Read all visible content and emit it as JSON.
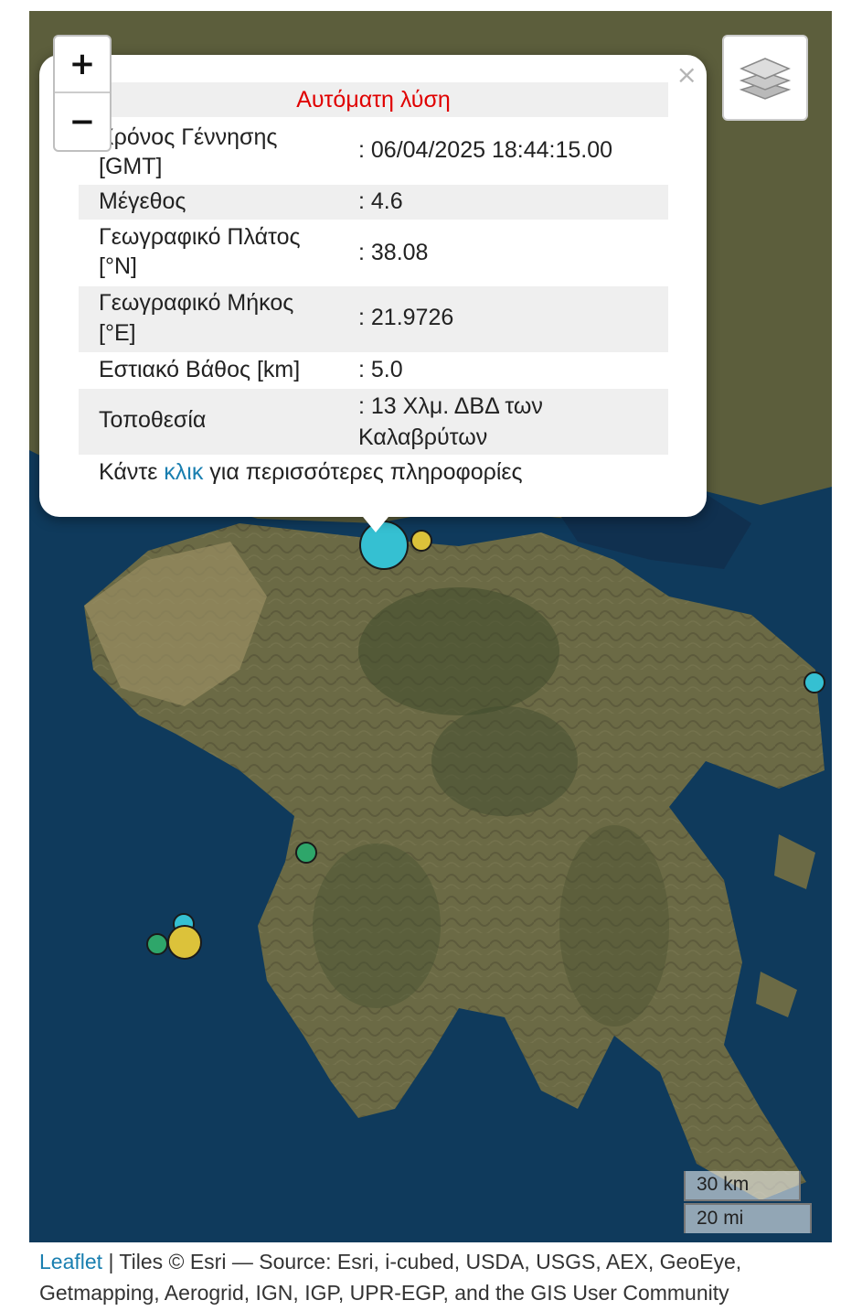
{
  "zoom": {
    "in_label": "+",
    "out_label": "−"
  },
  "layers": {
    "icon": "layers-icon"
  },
  "popup": {
    "close_label": "×",
    "title": "Αυτόματη λύση",
    "rows": [
      {
        "label": "Χρόνος Γέννησης [GMT]",
        "value": ": 06/04/2025 18:44:15.00"
      },
      {
        "label": "Μέγεθος",
        "value": ": 4.6"
      },
      {
        "label": "Γεωγραφικό Πλάτος [°N]",
        "value": ": 38.08"
      },
      {
        "label": "Γεωγραφικό Μήκος [°E]",
        "value": ": 21.9726"
      },
      {
        "label": "Εστιακό Βάθος [km]",
        "value": ": 5.0"
      },
      {
        "label": "Τοποθεσία",
        "value": ": 13 Χλμ. ΔΒΔ των Καλαβρύτων"
      }
    ],
    "more_prefix": "Κάντε ",
    "more_link": "κλικ",
    "more_suffix": " για περισσότερες πληροφορίες"
  },
  "scale": {
    "km": "30 km",
    "mi": "20 mi"
  },
  "attribution": {
    "link": "Leaflet",
    "text": " | Tiles © Esri — Source: Esri, i-cubed, USDA, USGS, AEX, GeoEye, Getmapping, Aerogrid, IGN, IGP, UPR-EGP, and the GIS User Community"
  },
  "colors": {
    "popup_title": "#e00000",
    "link": "#1a7fb0",
    "sea": "#0f3a5c",
    "land": "#6b6a45",
    "marker_cyan": "#35c0d2",
    "marker_yellow": "#dcc23a",
    "marker_green": "#2ea66a"
  }
}
